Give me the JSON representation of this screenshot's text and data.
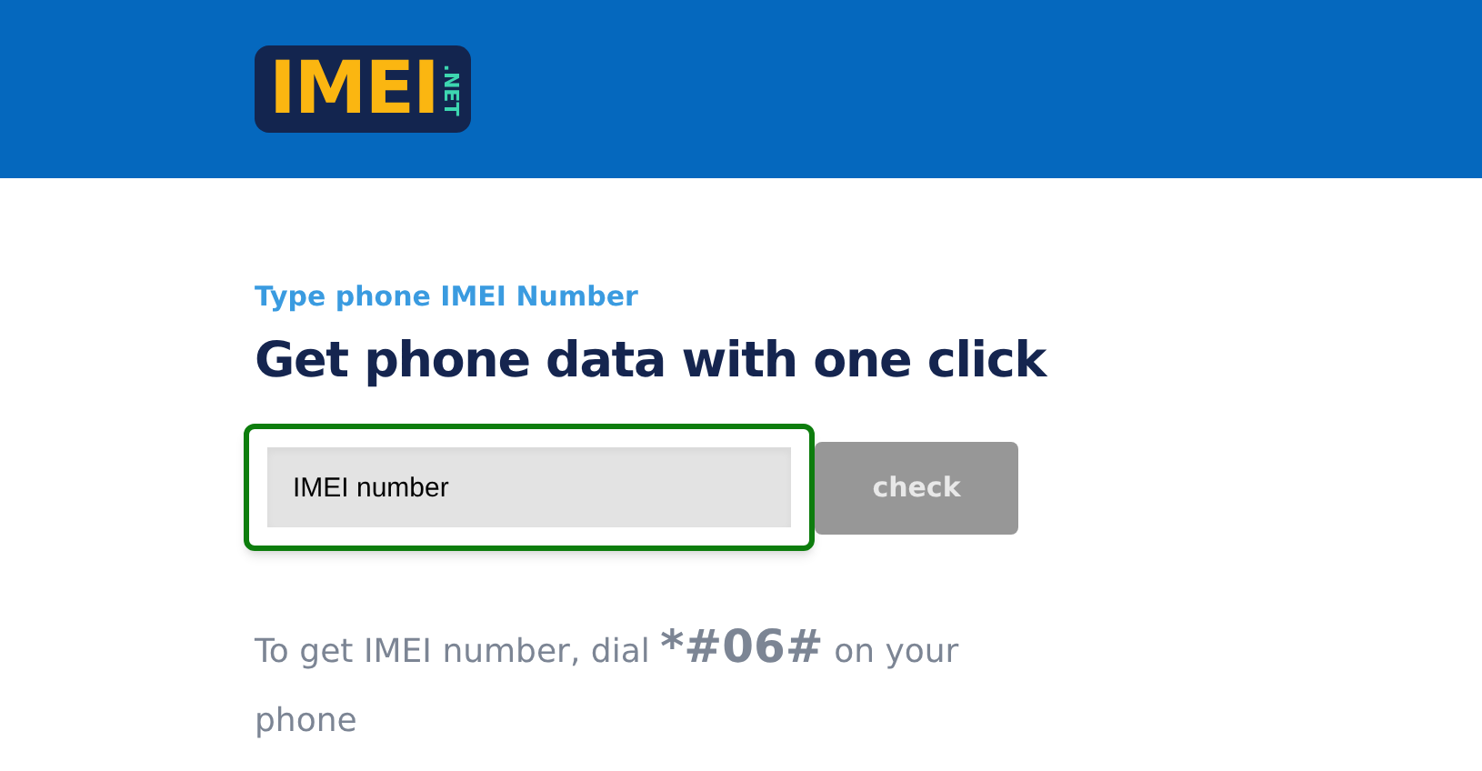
{
  "header": {
    "logo": {
      "main": "IMEI",
      "suffix": ".NET"
    }
  },
  "subtitle": "Type phone IMEI Number",
  "heading": "Get phone data with one click",
  "search": {
    "placeholder": "IMEI number",
    "focused": true
  },
  "button": "check",
  "hint": {
    "before": "To get IMEI number, dial",
    "code": "*#06#",
    "after": "on your phone"
  }
}
